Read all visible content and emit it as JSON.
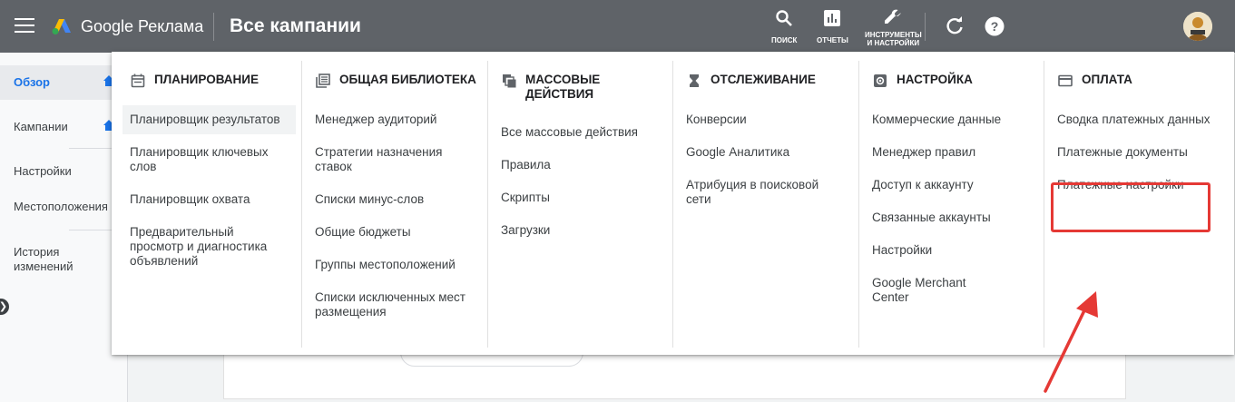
{
  "topbar": {
    "brand": "Google Реклама",
    "page_title": "Все кампании",
    "search_label": "ПОИСК",
    "reports_label": "ОТЧЕТЫ",
    "tools_label_line1": "ИНСТРУМЕНТЫ",
    "tools_label_line2": "И НАСТРОЙКИ",
    "icons": [
      "menu-icon",
      "google-ads-logo",
      "search-icon",
      "reports-icon",
      "wrench-icon",
      "refresh-icon",
      "help-icon",
      "avatar"
    ]
  },
  "sidebar": {
    "items": [
      {
        "label": "Обзор",
        "active": true
      },
      {
        "label": "Кампании"
      },
      {
        "label": "Настройки"
      },
      {
        "label": "Местоположения"
      },
      {
        "label_line1": "История",
        "label_line2": "изменений"
      }
    ]
  },
  "menu": {
    "columns": [
      {
        "title": "Планирование",
        "icon": "calendar-icon",
        "items": [
          "Планировщик результатов",
          "Планировщик ключевых слов",
          "Планировщик охвата",
          "Предварительный просмотр и диагностика объявлений"
        ]
      },
      {
        "title": "Общая библиотека",
        "icon": "library-icon",
        "items": [
          "Менеджер аудиторий",
          "Стратегии назначения ставок",
          "Списки минус-слов",
          "Общие бюджеты",
          "Группы местоположений",
          "Списки исключенных мест размещения"
        ]
      },
      {
        "title": "Массовые действия",
        "icon": "copy-icon",
        "items": [
          "Все массовые действия",
          "Правила",
          "Скрипты",
          "Загрузки"
        ]
      },
      {
        "title": "Отслеживание",
        "icon": "hourglass-icon",
        "items": [
          "Конверсии",
          "Google Аналитика",
          "Атрибуция в поисковой сети"
        ]
      },
      {
        "title": "Настройка",
        "icon": "gear-icon",
        "items": [
          "Коммерческие данные",
          "Менеджер правил",
          "Доступ к аккаунту",
          "Связанные аккаунты",
          "Настройки",
          "Google Merchant Center"
        ]
      },
      {
        "title": "Оплата",
        "icon": "credit-card-icon",
        "items": [
          "Сводка платежных данных",
          "Платежные документы",
          "Платежные настройки"
        ]
      }
    ]
  },
  "colors": {
    "topbar": "#5f6368",
    "accent": "#1a73e8",
    "highlight_box": "#e53935"
  }
}
